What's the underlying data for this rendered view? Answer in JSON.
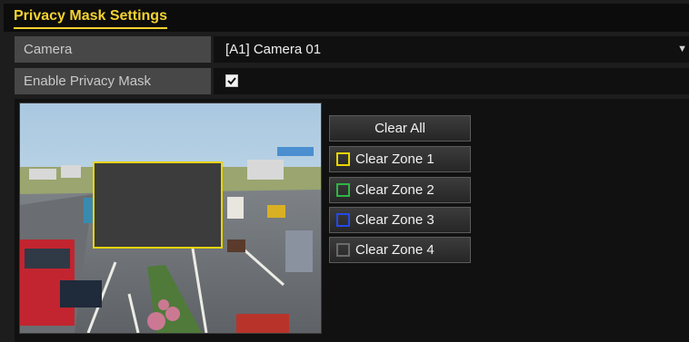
{
  "title": "Privacy Mask Settings",
  "camera": {
    "label": "Camera",
    "value": "[A1] Camera 01"
  },
  "enable_privacy_mask": {
    "label": "Enable Privacy Mask",
    "checked": true
  },
  "buttons": {
    "clear_all": "Clear All",
    "zones": [
      {
        "label": "Clear Zone 1",
        "color": "#e8d400"
      },
      {
        "label": "Clear Zone 2",
        "color": "#2fb443"
      },
      {
        "label": "Clear Zone 3",
        "color": "#2449e8"
      },
      {
        "label": "Clear Zone 4",
        "color": "#6a6a6a"
      }
    ]
  },
  "preview": {
    "mask_color": "#e8d400"
  },
  "colors": {
    "accent": "#f3d230",
    "label_bg": "#474747",
    "value_bg": "#101010",
    "panel_bg": "#1d1d1d"
  }
}
